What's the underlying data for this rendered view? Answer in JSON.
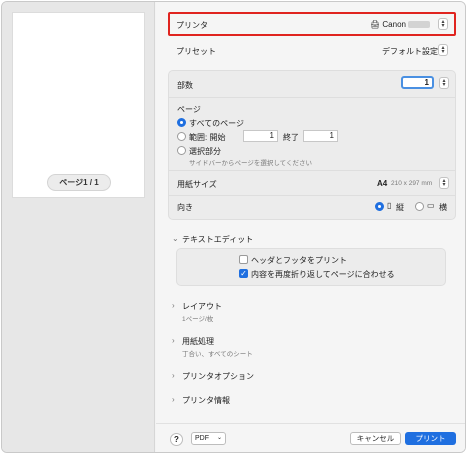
{
  "preview": {
    "page_indicator": "ページ1 / 1"
  },
  "printer": {
    "label": "プリンタ",
    "value": "Canon",
    "stepper": "⬆⬇"
  },
  "preset": {
    "label": "プリセット",
    "value": "デフォルト設定"
  },
  "copies": {
    "label": "部数",
    "value": "1"
  },
  "pages": {
    "label": "ページ",
    "all_label": "すべてのページ",
    "range_label": "範囲: 開始",
    "range_from": "1",
    "range_to_label": "終了",
    "range_to": "1",
    "selection_label": "選択部分",
    "selection_hint": "サイドバーからページを選択してください"
  },
  "paper_size": {
    "label": "用紙サイズ",
    "value": "A4",
    "dims": "210 x 297 mm"
  },
  "orientation": {
    "label": "向き",
    "portrait": "縦",
    "landscape": "横"
  },
  "text_edit": {
    "title": "テキストエディット",
    "header_footer": "ヘッダとフッタをプリント",
    "rewrap": "内容を再度折り返してページに合わせる"
  },
  "sections": {
    "layout": {
      "title": "レイアウト",
      "summary": "1ページ/枚"
    },
    "paper_handling": {
      "title": "用紙処理",
      "summary": "丁合い、すべてのシート"
    },
    "printer_options": {
      "title": "プリンタオプション"
    },
    "printer_info": {
      "title": "プリンタ情報"
    }
  },
  "footer": {
    "help": "?",
    "pdf": "PDF",
    "cancel": "キャンセル",
    "print": "プリント"
  },
  "colors": {
    "accent": "#1f6fe0",
    "highlight": "#e0241f"
  }
}
